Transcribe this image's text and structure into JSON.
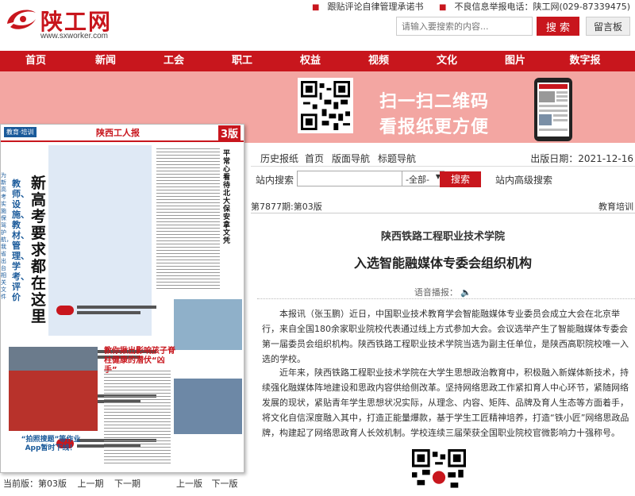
{
  "header": {
    "logo_text": "陕工网",
    "logo_url": "www.sxworker.com",
    "toplink1": "跟贴评论自律管理承诺书",
    "toplink2": "不良信息举报电话：陕工网(029-87339475)",
    "search_placeholder": "请输入要搜索的内容...",
    "search_label": "搜 索",
    "message_label": "留言板"
  },
  "nav": [
    "首页",
    "新闻",
    "工会",
    "职工",
    "权益",
    "视频",
    "文化",
    "图片",
    "数字报"
  ],
  "banner": {
    "line1": "扫一扫二维码",
    "line2": "看报纸更方便"
  },
  "paper": {
    "section_tag": "教育·培训",
    "masthead": "陕西工人报",
    "page_no": "3版",
    "headline": "新高考要求都在这里",
    "subline": "教师、设施、教材、管理、学考、评价",
    "side_note": "为新高考实施保驾护航，我省出台相关文件",
    "right_title": "平常心看待北大保安拿文凭",
    "kid_title": "教你揪出影响孩子脊柱健康的潜伏“凶手”",
    "app_title": "“拍照搜题”等作业App暂时下线！"
  },
  "paper_nav": {
    "current": "当前版：第03版",
    "prev_issue": "上一期",
    "next_issue": "下一期",
    "prev_page": "上一版",
    "next_page": "下一版"
  },
  "tools": {
    "history": "历史报纸",
    "home": "首页",
    "layout_nav": "版面导航",
    "title_nav": "标题导航",
    "pubdate": "出版日期：2021-12-16"
  },
  "site_search": {
    "label": "站内搜索",
    "select": "-全部-",
    "button": "搜索",
    "advanced": "站内高级搜索"
  },
  "article": {
    "issue": "第7877期:第03版",
    "section": "教育培训",
    "subtitle": "陕西铁路工程职业技术学院",
    "title": "入选智能融媒体专委会组织机构",
    "voice": "语音播报：",
    "para1": "本报讯（张玉鹏）近日，中国职业技术教育学会智能融媒体专业委员会成立大会在北京举行，来自全国180余家职业院校代表通过线上方式参加大会。会议选举产生了智能融媒体专委会第一届委员会组织机构。陕西铁路工程职业技术学院当选为副主任单位，是陕西高职院校唯一入选的学校。",
    "para2": "近年来，陕西铁路工程职业技术学院在大学生思想政治教育中，积极融入新媒体新技术，持续强化融媒体阵地建设和思政内容供给侧改革。坚持网络思政工作紧扣育人中心环节，紧随网络发展的现状，紧贴青年学生思想状况实际，从理念、内容、矩阵、品牌及育人生态等方面着手，将文化自信深度融入其中，打造正能量爆款，基于学生工匠精神培养，打造“铁小匠”网络思政品牌，构建起了网络思政育人长效机制。学校连续三届荣获全国职业院校官微影响力十强称号。"
  },
  "colors": {
    "brand_red": "#c8161d",
    "banner_pink": "#f3a6a2"
  },
  "icons": [
    "logo-swirl-icon",
    "notice-icon",
    "warning-icon",
    "speaker-icon",
    "qr-code-icon",
    "phone-icon"
  ]
}
